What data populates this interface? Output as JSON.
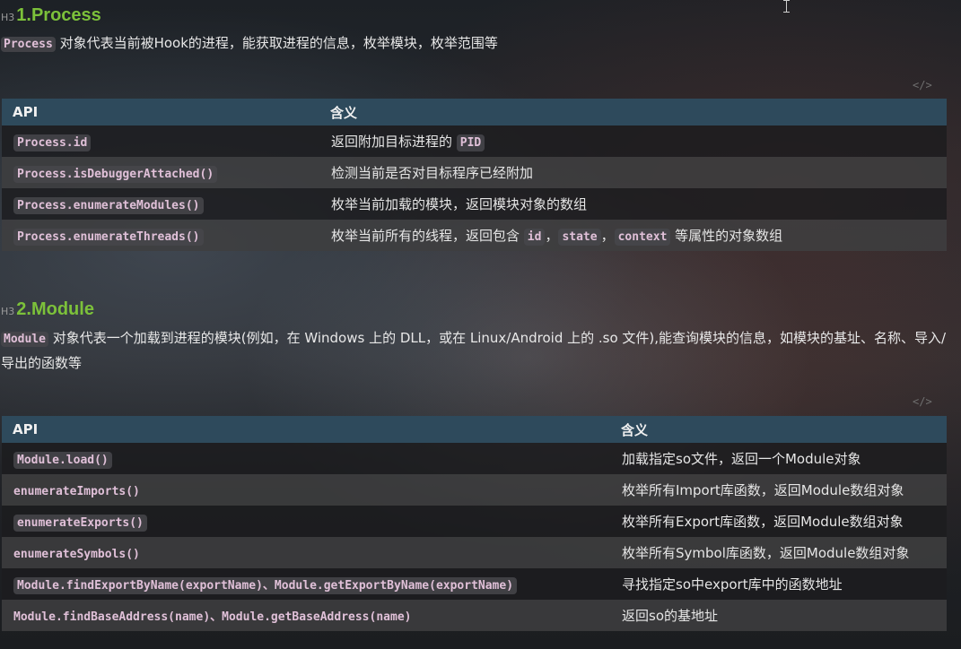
{
  "section1": {
    "tag": "H3",
    "title": "1.Process",
    "intro_code": "Process",
    "intro_text": " 对象代表当前被Hook的进程，能获取进程的信息，枚举模块，枚举范围等",
    "code_marker": "</>",
    "headers": [
      "API",
      "含义"
    ],
    "rows": [
      {
        "api": "Process.id",
        "desc_before": "返回附加目标进程的 ",
        "desc_code": "PID",
        "desc_after": ""
      },
      {
        "api": "Process.isDebuggerAttached()",
        "desc_before": "检测当前是否对目标程序已经附加",
        "desc_code": "",
        "desc_after": ""
      },
      {
        "api": "Process.enumerateModules()",
        "desc_before": "枚举当前加载的模块，返回模块对象的数组",
        "desc_code": "",
        "desc_after": ""
      },
      {
        "api": "Process.enumerateThreads()",
        "desc_before": "枚举当前所有的线程，返回包含 ",
        "codes": [
          "id",
          "state",
          "context"
        ],
        "desc_after": " 等属性的对象数组"
      }
    ]
  },
  "section2": {
    "tag": "H3",
    "title": "2.Module",
    "intro_code": "Module",
    "intro_text": " 对象代表一个加载到进程的模块(例如，在 Windows 上的 DLL，或在 Linux/Android 上的 .so 文件),能查询模块的信息，如模块的基址、名称、导入/导出的函数等",
    "code_marker": "</>",
    "headers": [
      "API",
      "含义"
    ],
    "rows": [
      {
        "api": "Module.load()",
        "bg": true,
        "desc": "加载指定so文件，返回一个Module对象"
      },
      {
        "api": "enumerateImports()",
        "bg": false,
        "desc": "枚举所有Import库函数，返回Module数组对象"
      },
      {
        "api": "enumerateExports()",
        "bg": true,
        "desc": "枚举所有Export库函数，返回Module数组对象"
      },
      {
        "api": "enumerateSymbols()",
        "bg": false,
        "desc": "枚举所有Symbol库函数，返回Module数组对象"
      },
      {
        "api": "Module.findExportByName(exportName)、Module.getExportByName(exportName)",
        "bg": true,
        "desc": "寻找指定so中export库中的函数地址"
      },
      {
        "api": "Module.findBaseAddress(name)、Module.getBaseAddress(name)",
        "bg": false,
        "desc": "返回so的基地址"
      }
    ]
  }
}
